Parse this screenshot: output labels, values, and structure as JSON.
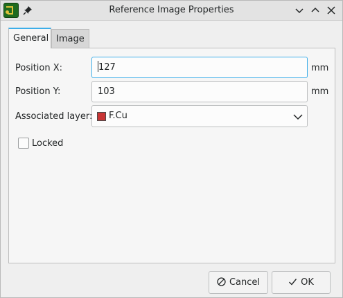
{
  "window": {
    "title": "Reference Image Properties",
    "icon": "kicad-pcbnew-icon"
  },
  "tabs": [
    {
      "label": "General",
      "active": true
    },
    {
      "label": "Image",
      "active": false
    }
  ],
  "general": {
    "position_x": {
      "label": "Position X:",
      "value": "127",
      "unit": "mm"
    },
    "position_y": {
      "label": "Position Y:",
      "value": "103",
      "unit": "mm"
    },
    "layer": {
      "label": "Associated layer:",
      "value": "F.Cu",
      "swatch_color": "#c83434"
    },
    "locked": {
      "label": "Locked",
      "checked": false
    }
  },
  "buttons": {
    "cancel": "Cancel",
    "ok": "OK"
  },
  "colors": {
    "focus_accent": "#3daee9"
  }
}
